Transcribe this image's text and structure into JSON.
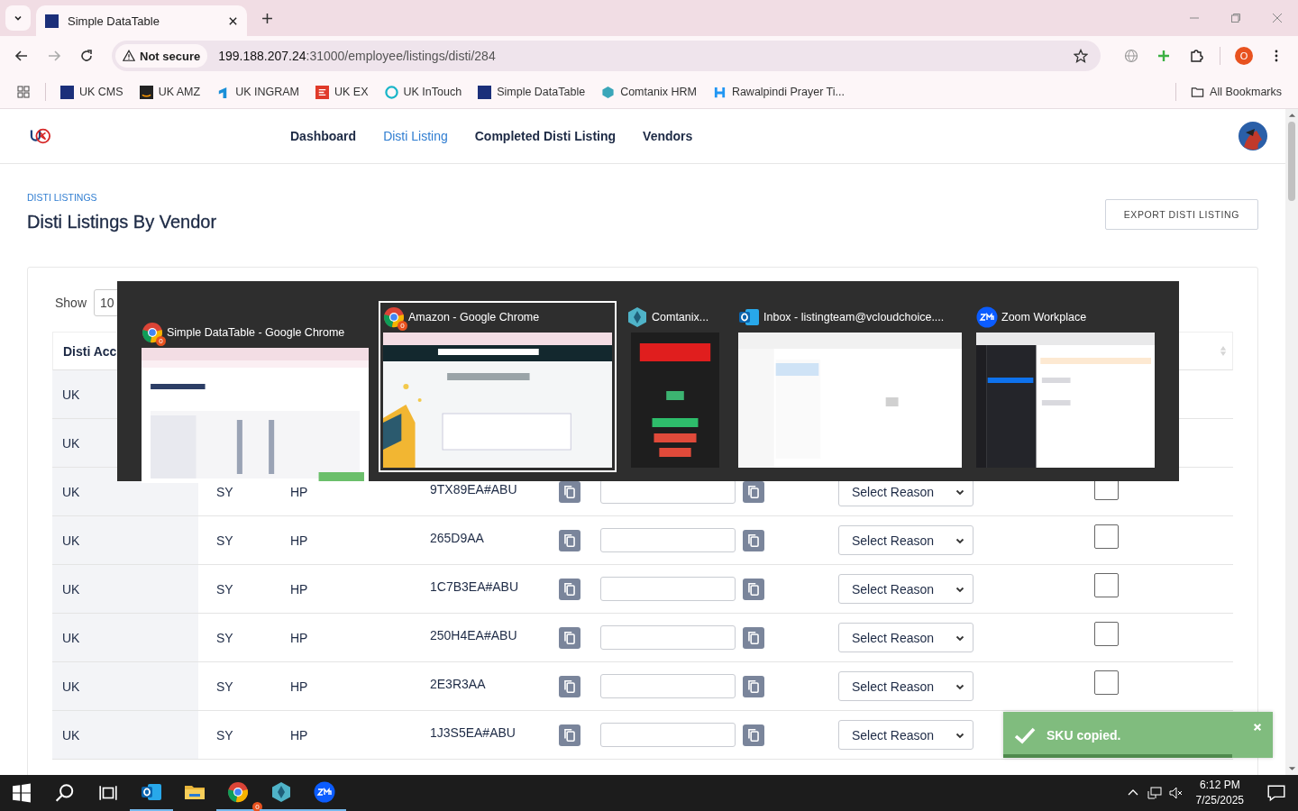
{
  "browser": {
    "tab_title": "Simple DataTable",
    "security": "Not secure",
    "url_host": "199.188.207.24",
    "url_rest": ":31000/employee/listings/disti/284",
    "profile": "O",
    "bookmarks": [
      {
        "label": "UK CMS",
        "kind": "df"
      },
      {
        "label": "UK AMZ",
        "kind": "amazon"
      },
      {
        "label": "UK INGRAM",
        "kind": "ingram"
      },
      {
        "label": "UK EX",
        "kind": "ex"
      },
      {
        "label": "UK InTouch",
        "kind": "intouch"
      },
      {
        "label": "Simple DataTable",
        "kind": "df"
      },
      {
        "label": "Comtanix HRM",
        "kind": "hex"
      },
      {
        "label": "Rawalpindi Prayer Ti...",
        "kind": "prayer"
      }
    ],
    "all_bookmarks": "All Bookmarks"
  },
  "nav": [
    {
      "label": "Dashboard",
      "selected": false
    },
    {
      "label": "Disti Listing",
      "selected": true
    },
    {
      "label": "Completed Disti Listing",
      "selected": false
    },
    {
      "label": "Vendors",
      "selected": false
    }
  ],
  "page": {
    "breadcrumb": "DISTI LISTINGS",
    "title": "Disti Listings By Vendor",
    "export_button": "EXPORT DISTI LISTING"
  },
  "table": {
    "show_label": "Show",
    "page_size": "10",
    "first_column": "Disti Acc",
    "rows": [
      {
        "account": "UK"
      },
      {
        "account": "UK"
      },
      {
        "account": "UK",
        "col2": "SY",
        "brand": "HP",
        "sku": "9TX89EA#ABU",
        "reason": "Select Reason",
        "checked": false
      },
      {
        "account": "UK",
        "col2": "SY",
        "brand": "HP",
        "sku": "265D9AA",
        "reason": "Select Reason",
        "checked": false
      },
      {
        "account": "UK",
        "col2": "SY",
        "brand": "HP",
        "sku": "1C7B3EA#ABU",
        "reason": "Select Reason",
        "checked": false
      },
      {
        "account": "UK",
        "col2": "SY",
        "brand": "HP",
        "sku": "250H4EA#ABU",
        "reason": "Select Reason",
        "checked": false
      },
      {
        "account": "UK",
        "col2": "SY",
        "brand": "HP",
        "sku": "2E3R3AA",
        "reason": "Select Reason",
        "checked": false
      },
      {
        "account": "UK",
        "col2": "SY",
        "brand": "HP",
        "sku": "1J3S5EA#ABU",
        "reason": "Select Reason"
      }
    ]
  },
  "switcher": {
    "windows": [
      {
        "title": "Simple DataTable - Google Chrome",
        "kind": "datatable",
        "badge": "0",
        "selected": false
      },
      {
        "title": "Amazon - Google Chrome",
        "kind": "amazon",
        "badge": "0",
        "selected": true
      },
      {
        "title": "Comtanix...",
        "kind": "comtanix",
        "selected": false
      },
      {
        "title": "Inbox - listingteam@vcloudchoice....",
        "kind": "outlook",
        "selected": false
      },
      {
        "title": "Zoom Workplace",
        "kind": "zoom",
        "selected": false
      }
    ]
  },
  "toast": {
    "message": "SKU copied.",
    "level": 0.85
  },
  "taskbar": {
    "apps": [
      {
        "kind": "outlook",
        "active": true
      },
      {
        "kind": "folder",
        "active": false
      },
      {
        "kind": "chrome",
        "active": true,
        "badge": "0"
      },
      {
        "kind": "hex",
        "active": true
      },
      {
        "kind": "zoom",
        "active": true
      }
    ],
    "time": "6:12 PM",
    "date": "7/25/2025"
  }
}
